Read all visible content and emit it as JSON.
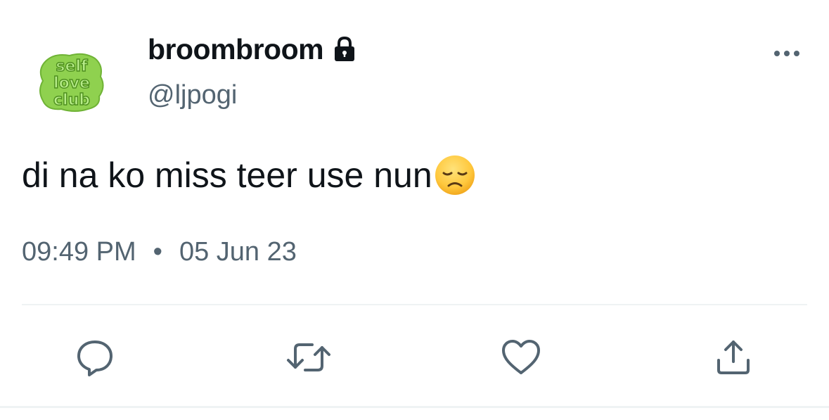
{
  "user": {
    "display_name": "broombroom",
    "handle": "@ljpogi",
    "protected": true,
    "avatar_text": [
      "self",
      "love",
      "club"
    ]
  },
  "tweet": {
    "text": "di na ko miss teer use nun",
    "emoji": "disappointed-face",
    "time": "09:49 PM",
    "separator": "•",
    "date": "05 Jun 23"
  },
  "colors": {
    "text_primary": "#0f1419",
    "text_secondary": "#536471",
    "divider": "#eff3f4",
    "avatar_green": "#8fd14f",
    "avatar_green_dark": "#4e8f1f",
    "emoji_yellow": "#ffc83d"
  },
  "icons": {
    "lock": "lock-icon",
    "more": "more-horizontal-icon",
    "reply": "reply-icon",
    "retweet": "retweet-icon",
    "like": "heart-icon",
    "share": "share-icon"
  }
}
